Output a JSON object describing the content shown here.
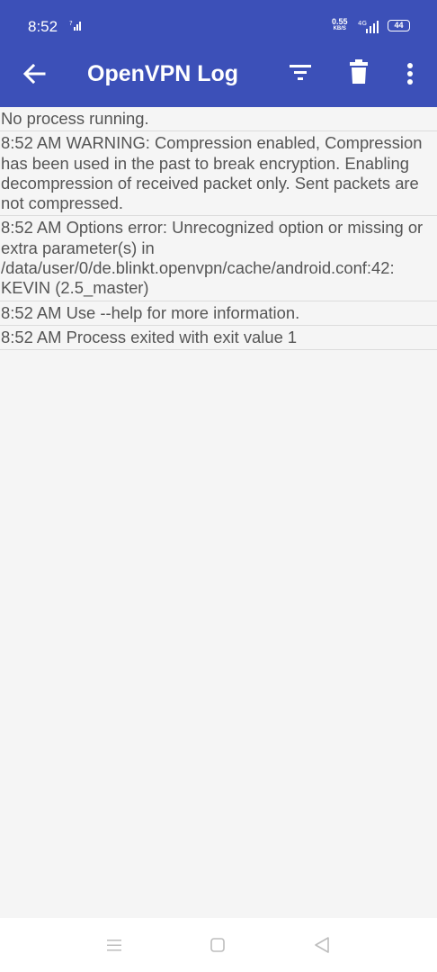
{
  "status_bar": {
    "time": "8:52",
    "speed_value": "0.55",
    "speed_unit": "KB/S",
    "network": "4G",
    "battery": "44"
  },
  "app_bar": {
    "title": "OpenVPN Log",
    "icons": [
      "back-arrow-icon",
      "filter-icon",
      "delete-icon",
      "more-vert-icon"
    ]
  },
  "log": {
    "entries": [
      "No process running.",
      "8:52 AM WARNING:  Compression enabled, Compression has been used in the past to break encryption. Enabling decompression of received packet only. Sent packets are not compressed.",
      "8:52 AM Options error: Unrecognized option or missing or extra parameter(s) in /data/user/0/de.blinkt.openvpn/cache/android.conf:42: KEVIN (2.5_master)",
      "8:52 AM Use --help for more information.",
      "8:52 AM Process exited with exit value 1"
    ]
  },
  "nav_bar": {
    "icons": [
      "recents-icon",
      "home-icon",
      "back-icon"
    ]
  },
  "colors": {
    "primary": "#3c50b8",
    "background": "#f5f5f5",
    "log_text": "#555555"
  }
}
